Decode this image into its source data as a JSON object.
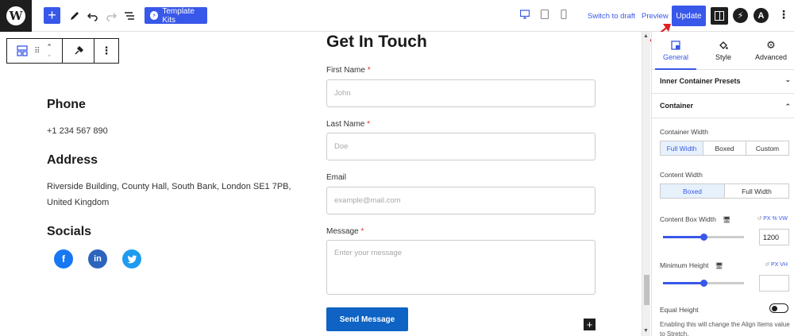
{
  "toolbar": {
    "template_kits_label": "Template Kits",
    "switch_to_draft_label": "Switch to draft",
    "preview_label": "Preview",
    "update_label": "Update"
  },
  "content": {
    "phone_heading": "Phone",
    "phone_value": "+1 234 567 890",
    "address_heading": "Address",
    "address_value": "Riverside Building, County Hall, South Bank, London SE1 7PB, United Kingdom",
    "socials_heading": "Socials"
  },
  "form": {
    "title": "Get In Touch",
    "first_name_label": "First Name",
    "first_name_placeholder": "John",
    "last_name_label": "Last Name",
    "last_name_placeholder": "Doe",
    "email_label": "Email",
    "email_placeholder": "example@mail.com",
    "message_label": "Message",
    "message_placeholder": "Enter your message",
    "required_mark": "*",
    "send_label": "Send Message"
  },
  "panel": {
    "tabs": [
      {
        "label": "General",
        "active": true
      },
      {
        "label": "Style",
        "active": false
      },
      {
        "label": "Advanced",
        "active": false
      }
    ],
    "inner_presets_label": "Inner Container Presets",
    "container_label": "Container",
    "container_width_label": "Container Width",
    "container_width_options": [
      "Full Width",
      "Boxed",
      "Custom"
    ],
    "content_width_label": "Content Width",
    "content_width_options": [
      "Boxed",
      "Full Width"
    ],
    "content_box_width_label": "Content Box Width",
    "content_box_units": "PX % VW",
    "content_box_value": "1200",
    "content_box_slider_fraction": 0.5,
    "min_height_label": "Minimum Height",
    "min_height_units": "PX VH",
    "min_height_value": "",
    "min_height_slider_fraction": 0.5,
    "equal_height_label": "Equal Height",
    "equal_height_help": "Enabling this will change the Align Items value to Stretch."
  },
  "colors": {
    "accent": "#3858e9",
    "send_button": "#0e63c4",
    "facebook": "#1877f2",
    "linkedin": "#2d64bc",
    "twitter": "#1d9bf0",
    "required": "#e0302f"
  }
}
